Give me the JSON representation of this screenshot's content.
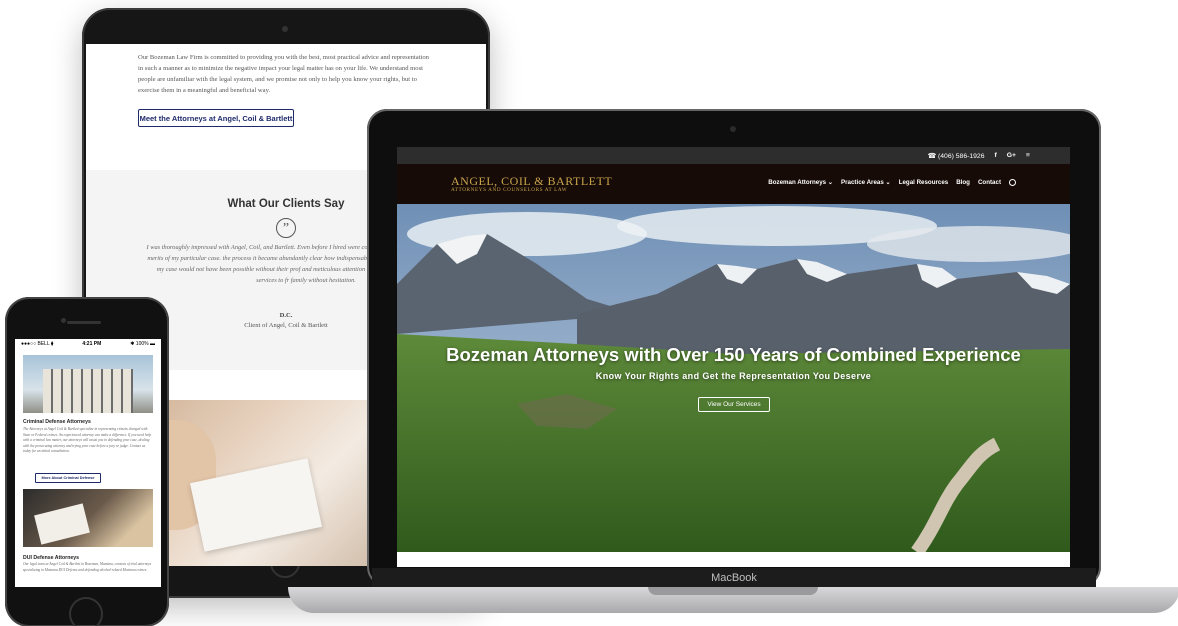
{
  "tablet": {
    "intro_text": "Our Bozeman Law Firm is committed to providing you with the best, most practical advice and representation in such a manner as to minimize the negative impact your legal matter has on your life. We understand most people are unfamiliar with the legal system, and we promise not only to help you know your rights, but to exercise them in a meaningful and beneficial way.",
    "attorneys_button": "Meet the Attorneys at Angel, Coil & Bartlett",
    "testimonials_heading": "What Our Clients Say",
    "quote_icon": "quote-icon",
    "quote_text": "I was thoroughly impressed with Angel, Coil, and Bartlett. Even before I hired were completely upfront and helpful about the merits of my particular case. the process it became abundantly clear how indispensable their services w positive outcome of my case would not have been possible without their prof and meticulous attention to detail. I would recommend their services to fr family without hesitation.",
    "author": "D.C.",
    "author_sub": "Client of Angel, Coil & Bartlett"
  },
  "laptop": {
    "topbar": {
      "phone": "☎ (406) 586-1926",
      "facebook": "f",
      "googleplus": "G+",
      "rss": "≡"
    },
    "logo": {
      "name": "ANGEL, COIL & BARTLETT",
      "tagline": "ATTORNEYS AND COUNSELORS AT LAW"
    },
    "menu": [
      "Bozeman Attorneys ⌄",
      "Practice Areas ⌄",
      "Legal Resources",
      "Blog",
      "Contact"
    ],
    "hero": {
      "title": "Bozeman Attorneys with Over 150 Years of Combined Experience",
      "subtitle": "Know Your Rights and Get the Representation You Deserve",
      "button": "View Our Services"
    },
    "brand_label": "MacBook"
  },
  "phone": {
    "status": {
      "carrier": "●●●○○ BELL ⧫",
      "time": "4:21 PM",
      "battery": "✱ 100% ▬"
    },
    "section1": {
      "heading": "Criminal Defense Attorneys",
      "text": "The Attorneys at Angel Coil & Bartlett specialize in representing citizens charged with State or Federal crimes. An experienced attorney can make a difference. If you need help with a criminal law matter, our attorneys will assist you in defending your case, dealing with the prosecuting attorney and trying your case before a jury or judge. Contact us today for an initial consultation.",
      "button": "More About Criminal Defense"
    },
    "section2": {
      "heading": "DUI Defense Attorneys",
      "text": "Our legal team at Angel Coil & Bartlett in Bozeman, Montana, consists of trial attorneys specializing in Montana DUI Defense and defending alcohol-related Montana crimes."
    }
  },
  "colors": {
    "navy": "#1f2a6b",
    "gold": "#c9a44a",
    "nav_bg": "#160b07",
    "topbar_bg": "#2d2d2d"
  }
}
